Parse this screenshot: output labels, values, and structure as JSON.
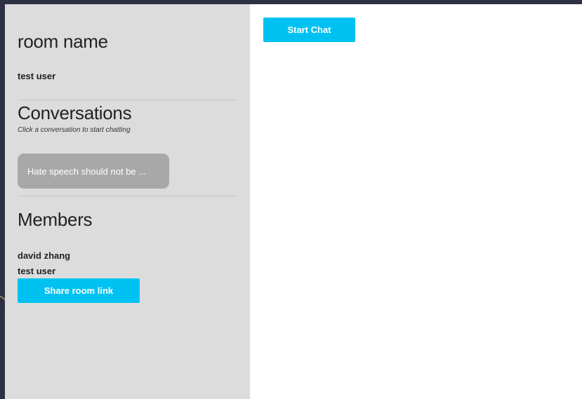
{
  "sidebar": {
    "room_name": "room name",
    "current_user": "test user",
    "conversations": {
      "title": "Conversations",
      "hint": "Click a conversation to start chatting",
      "items": [
        {
          "label": "Hate speech should not be ..."
        }
      ]
    },
    "members": {
      "title": "Members",
      "items": [
        {
          "name": "david zhang"
        },
        {
          "name": "test user"
        }
      ]
    },
    "share_button": "Share room link"
  },
  "main": {
    "start_chat_button": "Start Chat"
  },
  "colors": {
    "accent": "#00c2f2",
    "sidebar_bg": "#dcdcdc",
    "card_bg": "#a8a8a8",
    "backdrop": "#2c3144"
  }
}
